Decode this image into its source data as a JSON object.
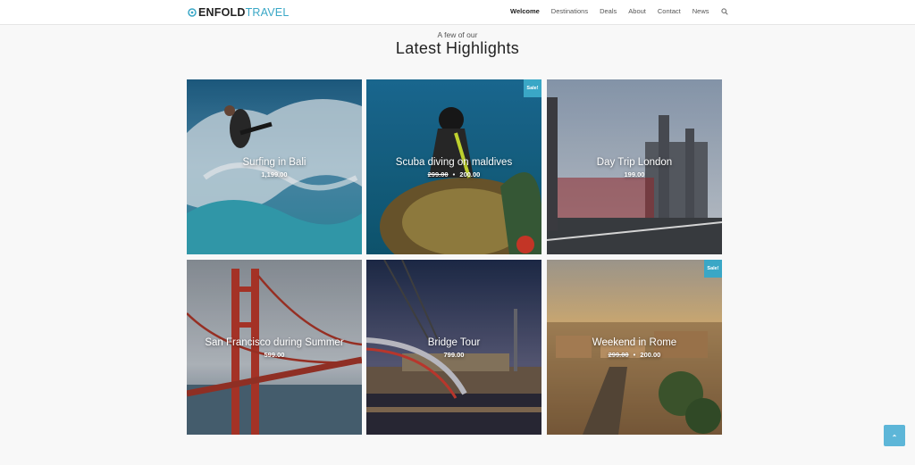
{
  "header": {
    "logo_bold": "ENFOLD",
    "logo_light": "TRAVEL",
    "nav": [
      "Welcome",
      "Destinations",
      "Deals",
      "About",
      "Contact",
      "News"
    ],
    "active_nav": "Welcome",
    "accent": "#3aa7c6"
  },
  "section": {
    "eyebrow": "A few of our",
    "title": "Latest Highlights"
  },
  "tiles": [
    {
      "name": "Surfing in Bali",
      "price": "1,199.00",
      "old_price": "",
      "sep": "",
      "sale": ""
    },
    {
      "name": "Scuba diving on maldives",
      "price": "200.00",
      "old_price": "299.00",
      "sep": "•",
      "sale": "Sale!"
    },
    {
      "name": "Day Trip London",
      "price": "199.00",
      "old_price": "",
      "sep": "",
      "sale": ""
    },
    {
      "name": "San Francisco during Summer",
      "price": "599.00",
      "old_price": "",
      "sep": "",
      "sale": ""
    },
    {
      "name": "Bridge Tour",
      "price": "799.00",
      "old_price": "",
      "sep": "",
      "sale": ""
    },
    {
      "name": "Weekend in Rome",
      "price": "200.00",
      "old_price": "299.00",
      "sep": "•",
      "sale": "Sale!"
    }
  ],
  "icons": {
    "logo": "target-icon",
    "search": "search-icon",
    "to_top": "chevron-up-icon"
  }
}
